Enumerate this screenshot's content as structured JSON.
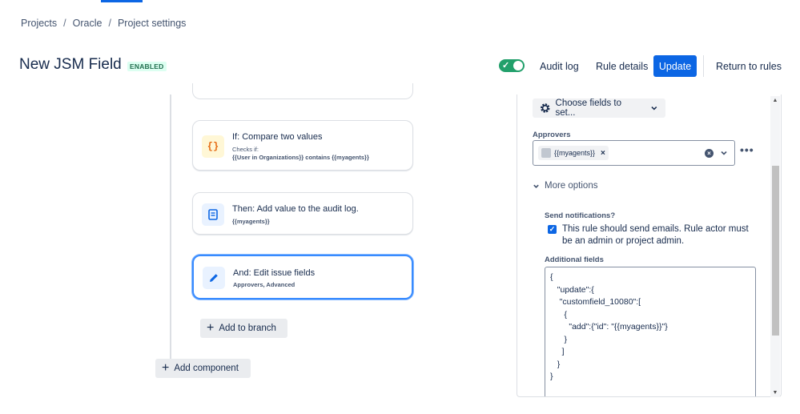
{
  "breadcrumb": {
    "items": [
      "Projects",
      "Oracle",
      "Project settings"
    ],
    "separator": "/"
  },
  "header": {
    "title": "New JSM Field",
    "status": "ENABLED",
    "toggle_on": true,
    "audit_log": "Audit log",
    "rule_details": "Rule details",
    "update": "Update",
    "return_to_rules": "Return to rules"
  },
  "flow": {
    "cards": [
      {
        "title": "If: Compare two values",
        "sub": "Checks if:",
        "detail": "{{User in Organizations}} contains {{myagents}}",
        "icon": "curly-braces-icon",
        "icon_glyph": "{}"
      },
      {
        "title": "Then: Add value to the audit log.",
        "detail": "{{myagents}}",
        "icon": "document-icon"
      },
      {
        "title": "And: Edit issue fields",
        "detail": "Approvers, Advanced",
        "icon": "pencil-icon"
      }
    ],
    "add_to_branch": "Add to branch",
    "add_component": "Add component",
    "plus_glyph": "+"
  },
  "panel": {
    "choose_fields": "Choose fields to set...",
    "approvers_label": "Approvers",
    "approver_chip": "{{myagents}}",
    "chip_remove_glyph": "×",
    "clear_glyph": "×",
    "more_glyph": "•••",
    "more_options": "More options",
    "send_notifications_label": "Send notifications?",
    "notify_checked": true,
    "notify_text": "This rule should send emails. Rule actor must be an admin or project admin.",
    "additional_fields_label": "Additional fields",
    "additional_fields_value": "{\n   \"update\":{\n    \"customfield_10080\":[\n      {\n        \"add\":{\"id\": \"{{myagents}}\"}\n      }\n     ]\n   }\n}"
  },
  "colors": {
    "primary": "#0c66e4",
    "success": "#22a06b",
    "selected_border": "#388bff"
  }
}
